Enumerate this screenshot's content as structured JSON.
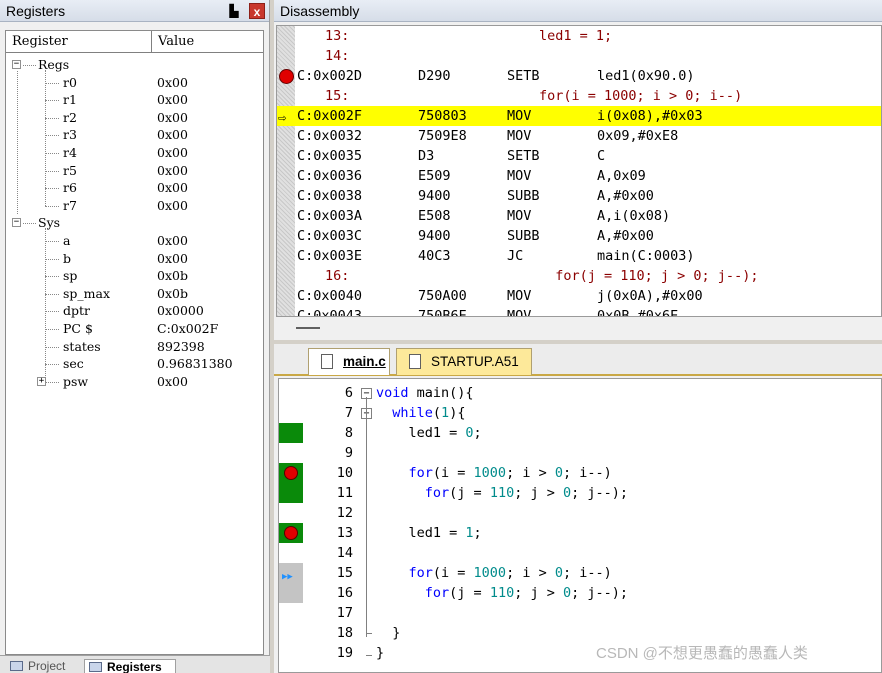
{
  "registers": {
    "title": "Registers",
    "pin_label": "ᵰ",
    "close_label": "x",
    "columns": [
      "Register",
      "Value"
    ],
    "groups": [
      {
        "name": "Regs",
        "expanded": true,
        "items": [
          {
            "name": "r0",
            "value": "0x00"
          },
          {
            "name": "r1",
            "value": "0x00"
          },
          {
            "name": "r2",
            "value": "0x00"
          },
          {
            "name": "r3",
            "value": "0x00"
          },
          {
            "name": "r4",
            "value": "0x00"
          },
          {
            "name": "r5",
            "value": "0x00"
          },
          {
            "name": "r6",
            "value": "0x00"
          },
          {
            "name": "r7",
            "value": "0x00"
          }
        ]
      },
      {
        "name": "Sys",
        "expanded": true,
        "items": [
          {
            "name": "a",
            "value": "0x00"
          },
          {
            "name": "b",
            "value": "0x00"
          },
          {
            "name": "sp",
            "value": "0x0b"
          },
          {
            "name": "sp_max",
            "value": "0x0b"
          },
          {
            "name": "dptr",
            "value": "0x0000"
          },
          {
            "name": "PC  $",
            "value": "C:0x002F"
          },
          {
            "name": "states",
            "value": "892398"
          },
          {
            "name": "sec",
            "value": "0.96831380"
          },
          {
            "name": "psw",
            "value": "0x00",
            "collapsed": true
          }
        ]
      }
    ]
  },
  "bottom_tabs": [
    "Project",
    "Registers"
  ],
  "disassembly": {
    "title": "Disassembly",
    "rows": [
      {
        "type": "src",
        "lineno": "13:",
        "text": "led1 = 1;"
      },
      {
        "type": "src",
        "lineno": "14:",
        "text": ""
      },
      {
        "type": "asm",
        "addr": "C:0x002D",
        "bytes": "D290",
        "mnem": "SETB",
        "ops": "led1(0x90.0)",
        "breakpoint": true
      },
      {
        "type": "src",
        "lineno": "15:",
        "text": "for(i = 1000; i > 0; i--)"
      },
      {
        "type": "asm",
        "addr": "C:0x002F",
        "bytes": "750803",
        "mnem": "MOV",
        "ops": "i(0x08),#0x03",
        "current": true
      },
      {
        "type": "asm",
        "addr": "C:0x0032",
        "bytes": "7509E8",
        "mnem": "MOV",
        "ops": "0x09,#0xE8"
      },
      {
        "type": "asm",
        "addr": "C:0x0035",
        "bytes": "D3",
        "mnem": "SETB",
        "ops": "C"
      },
      {
        "type": "asm",
        "addr": "C:0x0036",
        "bytes": "E509",
        "mnem": "MOV",
        "ops": "A,0x09"
      },
      {
        "type": "asm",
        "addr": "C:0x0038",
        "bytes": "9400",
        "mnem": "SUBB",
        "ops": "A,#0x00"
      },
      {
        "type": "asm",
        "addr": "C:0x003A",
        "bytes": "E508",
        "mnem": "MOV",
        "ops": "A,i(0x08)"
      },
      {
        "type": "asm",
        "addr": "C:0x003C",
        "bytes": "9400",
        "mnem": "SUBB",
        "ops": "A,#0x00"
      },
      {
        "type": "asm",
        "addr": "C:0x003E",
        "bytes": "40C3",
        "mnem": "JC",
        "ops": "main(C:0003)"
      },
      {
        "type": "src",
        "lineno": "16:",
        "text": "  for(j = 110; j > 0; j--);"
      },
      {
        "type": "asm",
        "addr": "C:0x0040",
        "bytes": "750A00",
        "mnem": "MOV",
        "ops": "j(0x0A),#0x00"
      },
      {
        "type": "asm",
        "addr": "C:0x0043",
        "bytes": "750B6E",
        "mnem": "MOV",
        "ops": "0x0B,#0x6E"
      }
    ]
  },
  "editor": {
    "tabs": [
      "main.c",
      "STARTUP.A51"
    ],
    "lines": [
      {
        "no": "6",
        "fold": "−",
        "code": [
          [
            "kw",
            "void"
          ],
          [
            "t",
            " main(){"
          ]
        ],
        "gutter": ""
      },
      {
        "no": "7",
        "fold": "−",
        "code": [
          [
            "t",
            "  "
          ],
          [
            "kw",
            "while"
          ],
          [
            "t",
            "("
          ],
          [
            "num",
            "1"
          ],
          [
            "t",
            "){"
          ]
        ],
        "gutter": ""
      },
      {
        "no": "8",
        "code": [
          [
            "t",
            "    led1 = "
          ],
          [
            "num",
            "0"
          ],
          [
            "t",
            ";"
          ]
        ],
        "gutter": "green"
      },
      {
        "no": "9",
        "code": [],
        "gutter": ""
      },
      {
        "no": "10",
        "code": [
          [
            "t",
            "    "
          ],
          [
            "kw",
            "for"
          ],
          [
            "t",
            "(i = "
          ],
          [
            "num",
            "1000"
          ],
          [
            "t",
            "; i > "
          ],
          [
            "num",
            "0"
          ],
          [
            "t",
            "; i--)"
          ]
        ],
        "gutter": "green-bp"
      },
      {
        "no": "11",
        "code": [
          [
            "t",
            "      "
          ],
          [
            "kw",
            "for"
          ],
          [
            "t",
            "(j = "
          ],
          [
            "num",
            "110"
          ],
          [
            "t",
            "; j > "
          ],
          [
            "num",
            "0"
          ],
          [
            "t",
            "; j--);"
          ]
        ],
        "gutter": "green"
      },
      {
        "no": "12",
        "code": [],
        "gutter": ""
      },
      {
        "no": "13",
        "code": [
          [
            "t",
            "    led1 = "
          ],
          [
            "num",
            "1"
          ],
          [
            "t",
            ";"
          ]
        ],
        "gutter": "green-bp"
      },
      {
        "no": "14",
        "code": [],
        "gutter": ""
      },
      {
        "no": "15",
        "code": [
          [
            "t",
            "    "
          ],
          [
            "kw",
            "for"
          ],
          [
            "t",
            "(i = "
          ],
          [
            "num",
            "1000"
          ],
          [
            "t",
            "; i > "
          ],
          [
            "num",
            "0"
          ],
          [
            "t",
            "; i--)"
          ]
        ],
        "gutter": "gray-cur"
      },
      {
        "no": "16",
        "code": [
          [
            "t",
            "      "
          ],
          [
            "kw",
            "for"
          ],
          [
            "t",
            "(j = "
          ],
          [
            "num",
            "110"
          ],
          [
            "t",
            "; j > "
          ],
          [
            "num",
            "0"
          ],
          [
            "t",
            "; j--);"
          ]
        ],
        "gutter": "gray"
      },
      {
        "no": "17",
        "code": [],
        "gutter": ""
      },
      {
        "no": "18",
        "code": [
          [
            "t",
            "  }"
          ]
        ],
        "gutter": ""
      },
      {
        "no": "19",
        "code": [
          [
            "t",
            "}"
          ]
        ],
        "gutter": ""
      }
    ]
  },
  "watermark": "CSDN @不想更愚蠢的愚蠢人类"
}
